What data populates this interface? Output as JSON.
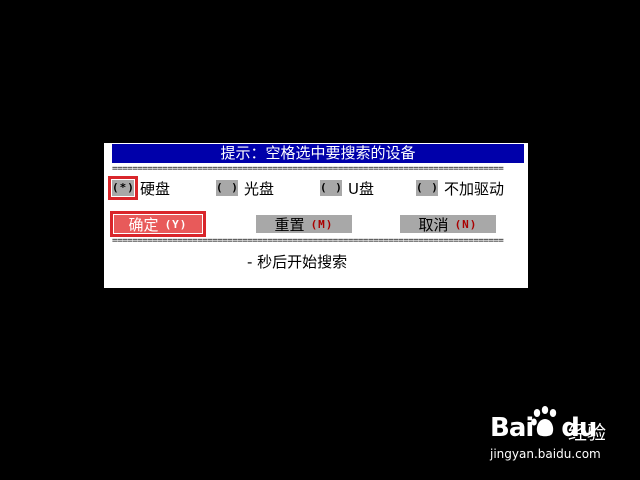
{
  "dialog": {
    "title": "提示：空格选中要搜索的设备",
    "separator": "==============================================================================",
    "options": [
      {
        "box": "(*)",
        "label": "硬盘",
        "checked": true
      },
      {
        "box": "( )",
        "label": "光盘",
        "checked": false
      },
      {
        "box": "( )",
        "label": "U盘",
        "checked": false
      },
      {
        "box": "( )",
        "label": "不加驱动",
        "checked": false
      }
    ],
    "buttons": {
      "ok": {
        "label": "确定",
        "hotkey": "(Y)"
      },
      "reset": {
        "label": "重置",
        "hotkey": "(M)"
      },
      "cancel": {
        "label": "取消",
        "hotkey": "(N)"
      }
    },
    "countdown_text": "- 秒后开始搜索"
  },
  "watermark": {
    "brand": "Bai",
    "brand_suffix": "du",
    "service": "经验",
    "url": "jingyan.baidu.com"
  },
  "colors": {
    "title_bg": "#0000aa",
    "button_bg": "#a8a8a8",
    "active_button_bg": "#e85a5a",
    "highlight_frame": "#d9262b",
    "hotkey": "#aa0000"
  }
}
